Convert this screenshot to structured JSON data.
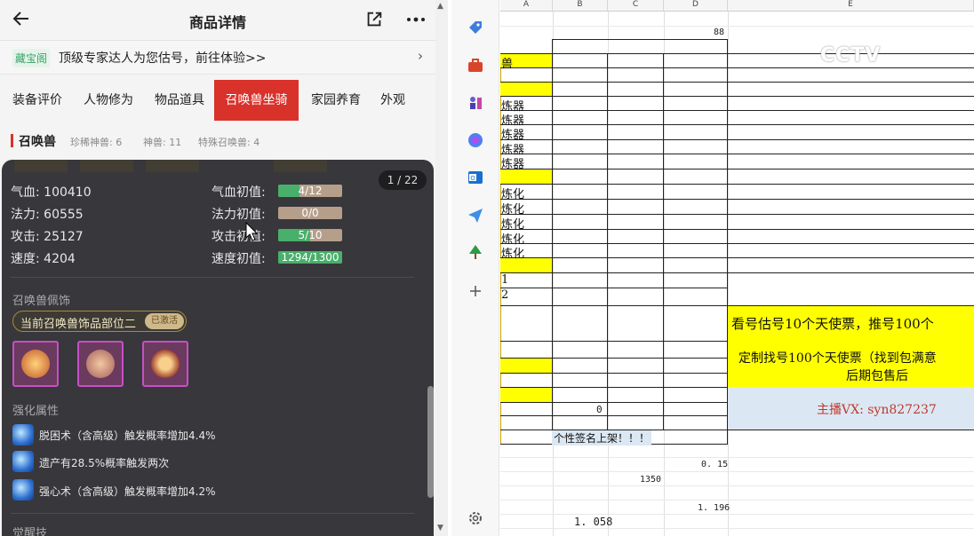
{
  "topbar": {
    "title": "商品详情"
  },
  "banner": {
    "tag": "藏宝阁",
    "text": "顶级专家达人为您估号，前往体验>>",
    "arrow": "›"
  },
  "tabs": [
    {
      "label": "装备评价"
    },
    {
      "label": "人物修为"
    },
    {
      "label": "物品道具"
    },
    {
      "label": "召唤兽坐骑"
    },
    {
      "label": "家园养育"
    },
    {
      "label": "外观"
    }
  ],
  "section": {
    "title": "召唤兽",
    "stats": [
      "珍稀神兽: 6",
      "神兽: 11",
      "特殊召唤兽: 4"
    ]
  },
  "overlay": {
    "pager": "1 / 22",
    "stats": [
      {
        "label": "气血: 100410"
      },
      {
        "label": "法力: 60555"
      },
      {
        "label": "攻击: 25127"
      },
      {
        "label": "速度: 4204"
      }
    ],
    "inits": [
      {
        "label": "气血初值:",
        "value": "4/12",
        "fraction": 0.333
      },
      {
        "label": "法力初值:",
        "value": "0/0",
        "fraction": 0
      },
      {
        "label": "攻击初值:",
        "value": "5/10",
        "fraction": 0.5
      },
      {
        "label": "速度初值:",
        "value": "1294/1300",
        "fraction": 0.995
      }
    ],
    "deco_title": "召唤兽佩饰",
    "deco_pill": "当前召唤兽饰品部位二",
    "deco_badge": "已激活",
    "enhance_title": "强化属性",
    "skills": [
      {
        "text": "脱困术（含高级）触发概率增加4.4%"
      },
      {
        "text": "遗产有28.5%概率触发两次"
      },
      {
        "text": "强心术（含高级）触发概率增加4.2%"
      }
    ],
    "awaken_title": "觉醒技"
  },
  "sheet": {
    "columns": [
      "A",
      "B",
      "C",
      "D",
      "E"
    ],
    "d_top": "88",
    "a_texts": [
      "兽",
      "炼器",
      "炼器",
      "炼器",
      "炼器",
      "炼器",
      "炼化",
      "炼化",
      "炼化",
      "炼化",
      "炼化",
      "1",
      "2"
    ],
    "b_zero": "0",
    "signature": "个性签名上架！！！",
    "d_015": "0. 15",
    "c_1350": "1350",
    "d_1196": "1. 196",
    "b_1058": "1. 058",
    "e1": "看号估号10个天使票，推号100个",
    "e2": "定制找号100个天使票（找到包满意",
    "e3": "后期包售后",
    "e4": "主播VX: syn827237",
    "watermark": "CCTV"
  },
  "colors": {
    "tab_active": "#d9322b",
    "yellow": "#ffff00",
    "overlay": "#38373b",
    "bar_green": "#48b06a",
    "bar_tan": "#b59f8a",
    "light_blue": "#dbe7f3"
  }
}
